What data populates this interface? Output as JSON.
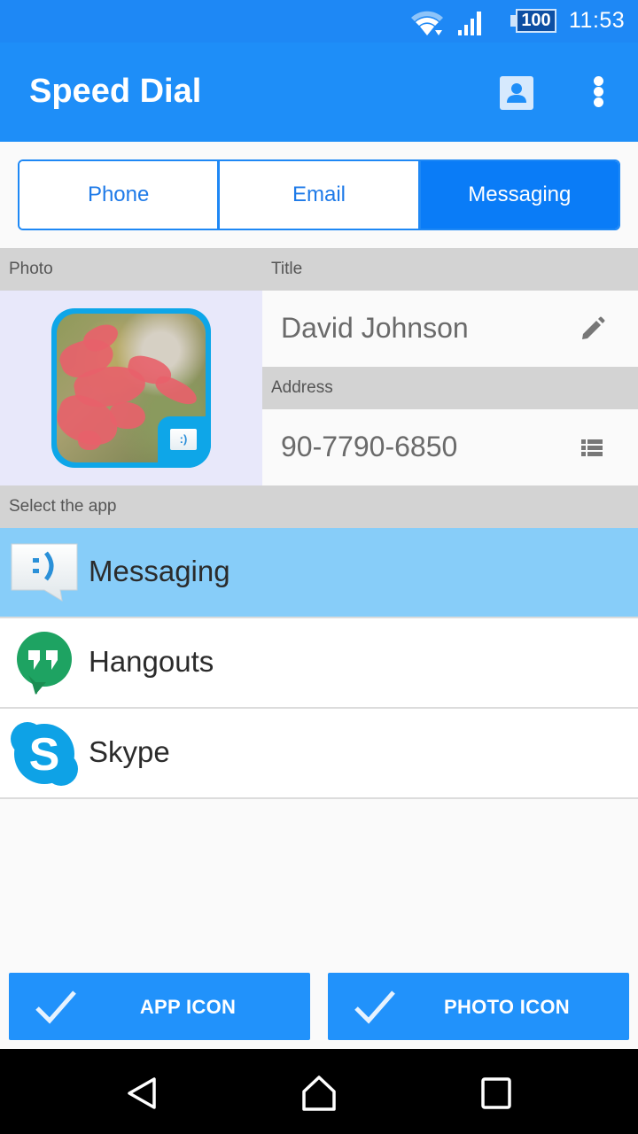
{
  "status_bar": {
    "battery_level": "100",
    "time": "11:53",
    "icons": [
      "wifi-icon",
      "cell-signal-icon",
      "battery-icon"
    ]
  },
  "app_bar": {
    "title": "Speed Dial",
    "actions": [
      "contact-icon",
      "more-vert-icon"
    ]
  },
  "tabs": [
    {
      "label": "Phone",
      "active": false
    },
    {
      "label": "Email",
      "active": false
    },
    {
      "label": "Messaging",
      "active": true
    }
  ],
  "sections": {
    "photo_label": "Photo",
    "title_label": "Title",
    "address_label": "Address",
    "select_app_label": "Select the app"
  },
  "contact": {
    "title": "David Johnson",
    "address": "90-7790-6850",
    "title_action_icon": "edit-pencil-icon",
    "address_action_icon": "list-icon"
  },
  "apps": [
    {
      "label": "Messaging",
      "icon": "messaging-icon",
      "selected": true
    },
    {
      "label": "Hangouts",
      "icon": "hangouts-icon",
      "selected": false
    },
    {
      "label": "Skype",
      "icon": "skype-icon",
      "selected": false
    }
  ],
  "actions": {
    "app_icon_label": "APP ICON",
    "photo_icon_label": "PHOTO ICON"
  },
  "colors": {
    "primary": "#1e8ef8",
    "tab_active": "#0a7cf7",
    "selected_row": "#87cdf9",
    "button": "#2192fb"
  }
}
